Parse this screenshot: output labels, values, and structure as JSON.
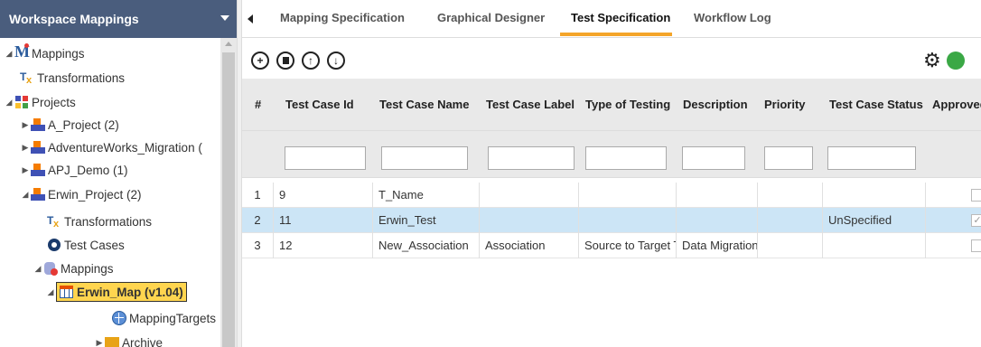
{
  "left_panel": {
    "title": "Workspace Mappings",
    "tree": [
      {
        "label": "Mappings",
        "icon": "mapping-root-icon"
      },
      {
        "label": "Transformations",
        "icon": "transformations-icon"
      },
      {
        "label": "Projects",
        "icon": "projects-icon"
      },
      {
        "label": "A_Project (2)",
        "icon": "project-folder-icon"
      },
      {
        "label": "AdventureWorks_Migration (",
        "icon": "project-folder-icon"
      },
      {
        "label": "APJ_Demo (1)",
        "icon": "project-folder-icon"
      },
      {
        "label": "Erwin_Project (2)",
        "icon": "project-folder-icon"
      },
      {
        "label": "Transformations",
        "icon": "transformations-icon"
      },
      {
        "label": "Test Cases",
        "icon": "test-cases-icon"
      },
      {
        "label": "Mappings",
        "icon": "mappings-db-icon"
      },
      {
        "label": "Erwin_Map (v1.04)",
        "icon": "map-table-icon"
      },
      {
        "label": "MappingTargets",
        "icon": "globe-icon"
      },
      {
        "label": "Archive",
        "icon": "archive-icon"
      }
    ]
  },
  "tabs": [
    "Mapping Specification",
    "Graphical Designer",
    "Test Specification",
    "Workflow Log"
  ],
  "active_tab": "Test Specification",
  "table": {
    "columns": [
      "#",
      "Test Case Id",
      "Test Case Name",
      "Test Case Label",
      "Type of Testing",
      "Description",
      "Priority",
      "Test Case Status",
      "Approved"
    ],
    "rows": [
      {
        "num": "1",
        "id": "9",
        "name": "T_Name",
        "label": "",
        "type": "",
        "desc": "",
        "priority": "",
        "status": "",
        "approved": false
      },
      {
        "num": "2",
        "id": "11",
        "name": "Erwin_Test",
        "label": "",
        "type": "",
        "desc": "",
        "priority": "",
        "status": "UnSpecified",
        "approved": true
      },
      {
        "num": "3",
        "id": "12",
        "name": "New_Association",
        "label": "Association",
        "type": "Source to Target Te",
        "desc": "Data Migration",
        "priority": "",
        "status": "",
        "approved": false
      }
    ],
    "selected_row": 2
  },
  "colors": {
    "header_bg": "#4a5d7d",
    "tab_accent": "#f4a52a",
    "selected_row": "#cce5f6",
    "selected_node": "#ffd54f"
  }
}
